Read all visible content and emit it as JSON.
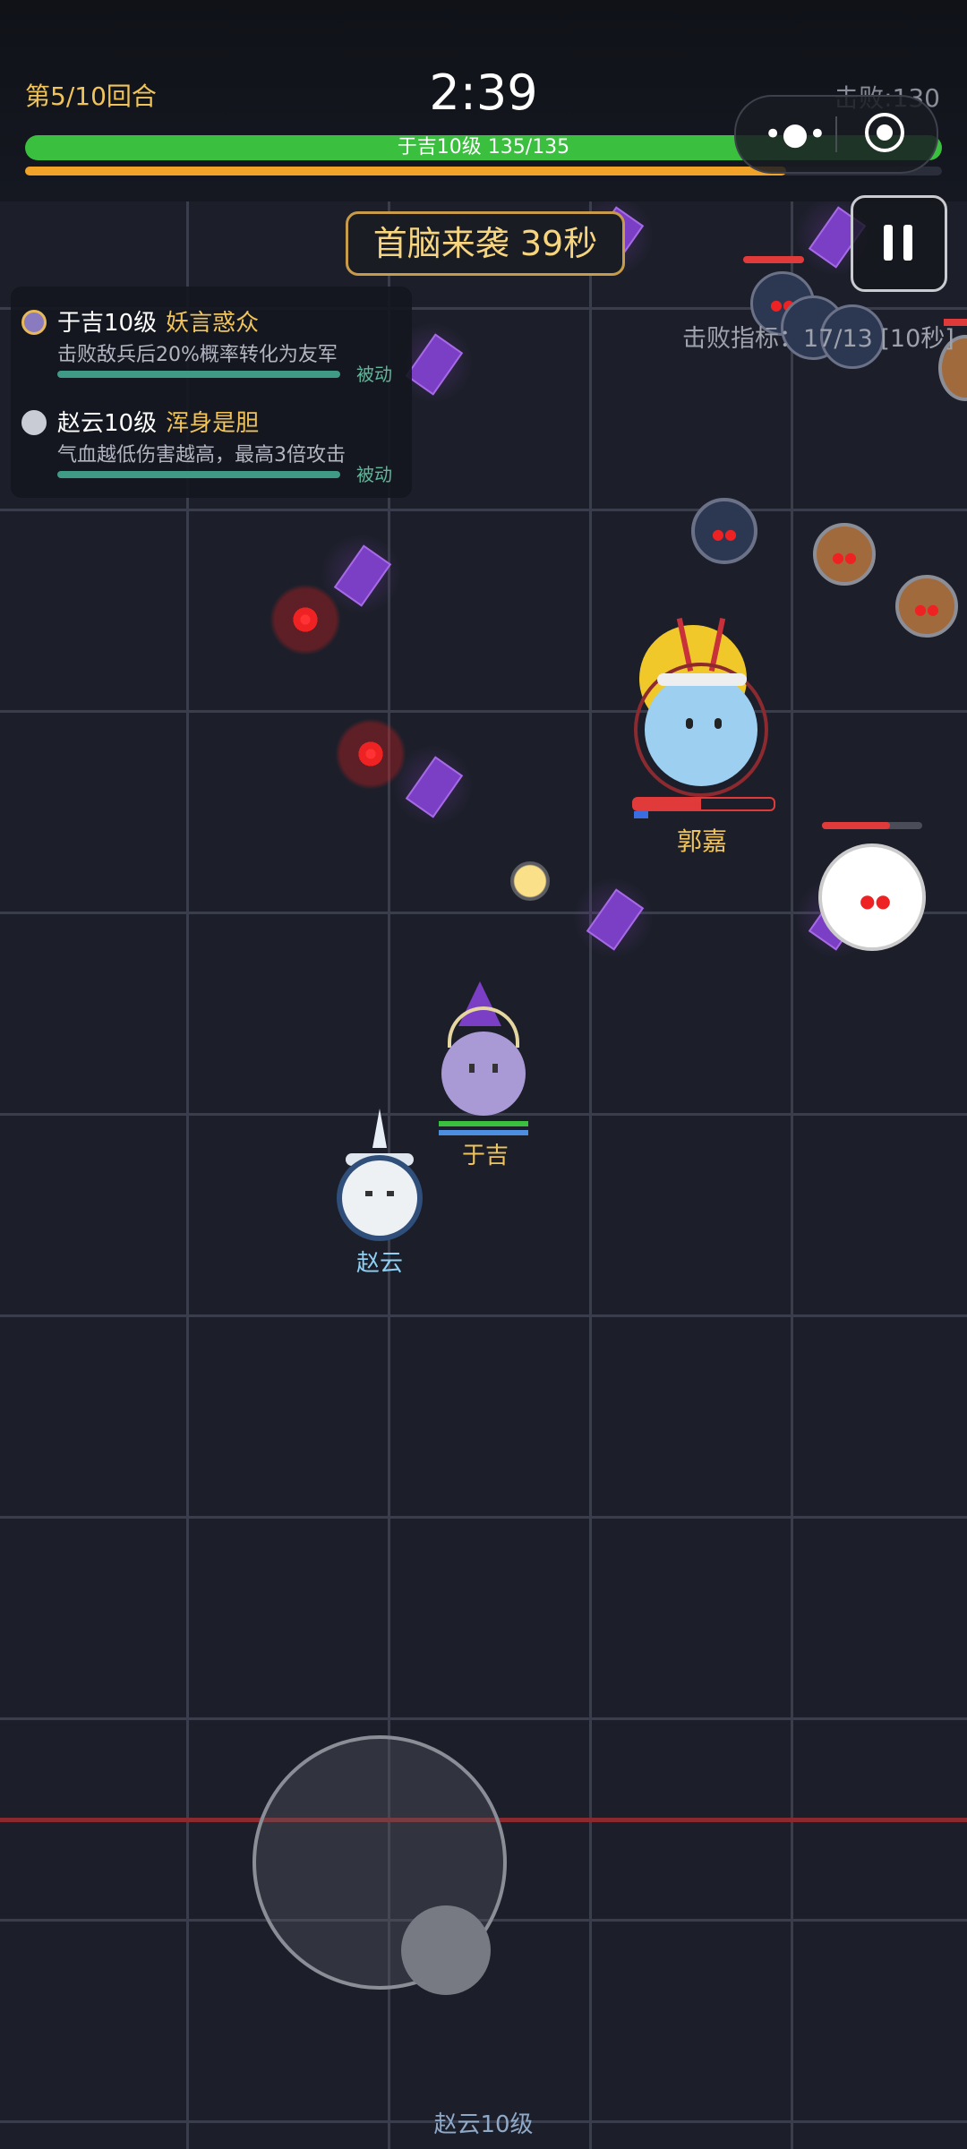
{
  "hud": {
    "round": "第5/10回合",
    "timer": "2:39",
    "kills": "击败:130",
    "hp_label": "于吉10级  135/135",
    "hp_value": 135,
    "hp_max": 135,
    "xp_progress": 0.83
  },
  "boss_banner": "首脑来袭 39秒",
  "kill_target": "击败指标：17/13 [10秒]",
  "skills": [
    {
      "hero": "于吉10级",
      "skill": "妖言惑众",
      "desc": "击败敌兵后20%概率转化为友军",
      "tag": "被动"
    },
    {
      "hero": "赵云10级",
      "skill": "浑身是胆",
      "desc": "气血越低伤害越高，最高3倍攻击",
      "tag": "被动"
    }
  ],
  "units": {
    "boss_name": "郭嘉",
    "player_name": "于吉",
    "ally_name": "赵云"
  },
  "bottom_label": "赵云10级",
  "icons": [
    "more-dots-icon",
    "target-icon",
    "pause-icon"
  ],
  "colors": {
    "hp": "#3bbf3f",
    "xp": "#f0a328",
    "gold": "#f0c45a",
    "enemy_hp": "#e03a3a"
  }
}
